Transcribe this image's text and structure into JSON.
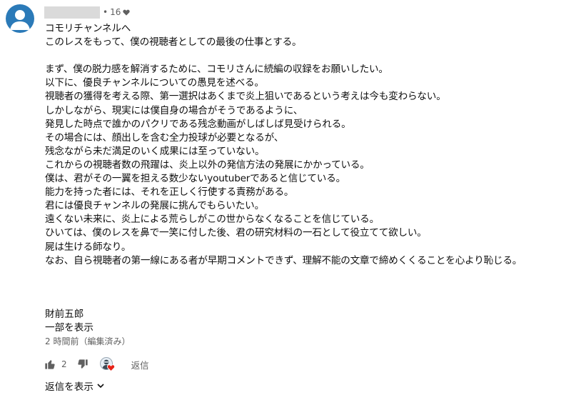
{
  "comment": {
    "meta": {
      "separator": "•",
      "heart_count": "16"
    },
    "body_lines": [
      "コモリチャンネルへ",
      "このレスをもって、僕の視聴者としての最後の仕事とする。",
      "",
      "まず、僕の脱力感を解消するために、コモリさんに続編の収録をお願いしたい。",
      "以下に、優良チャンネルについての愚見を述べる。",
      "視聴者の獲得を考える際、第一選択はあくまで炎上狙いであるという考えは今も変わらない。",
      "しかしながら、現実には僕自身の場合がそうであるように、",
      "発見した時点で誰かのパクリである残念動画がしばしば見受けられる。",
      "その場合には、顔出しを含む全力投球が必要となるが、",
      "残念ながら未だ満足のいく成果には至っていない。",
      "これからの視聴者数の飛躍は、炎上以外の発信方法の発展にかかっている。",
      "僕は、君がその一翼を担える数少ないyoutuberであると信じている。",
      "能力を持った者には、それを正しく行使する責務がある。",
      "君には優良チャンネルの発展に挑んでもらいたい。",
      "遠くない未来に、炎上による荒らしがこの世からなくなることを信じている。",
      "ひいては、僕のレスを鼻で一笑に付した後、君の研究材料の一石として役立てて欲しい。",
      "屍は生ける師なり。",
      "なお、自ら視聴者の第一線にある者が早期コメントできず、理解不能の文章で締めくくることを心より恥じる。"
    ],
    "signature": "財前五郎",
    "show_part_label": "一部を表示",
    "timestamp": "2 時間前（編集済み）"
  },
  "actions": {
    "like_count": "2",
    "reply_label": "返信",
    "show_replies_label": "返信を表示"
  },
  "icons": {
    "like": "thumbs-up-icon",
    "dislike": "thumbs-down-icon",
    "creator_heart": "creator-heart-icon",
    "meta_heart": "heart-icon",
    "chevron": "chevron-down-icon"
  },
  "colors": {
    "text": "#0f0f0f",
    "secondary_text": "#606060",
    "avatar_bg": "#2b7ab8",
    "heart_red": "#e62117"
  }
}
